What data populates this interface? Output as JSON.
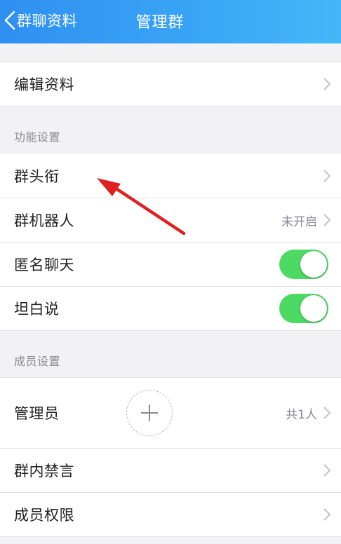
{
  "header": {
    "back_label": "群聊资料",
    "title": "管理群"
  },
  "rows": {
    "edit_info": "编辑资料",
    "title_badge": "群头衔",
    "group_bot": "群机器人",
    "group_bot_value": "未开启",
    "anonymous_chat": "匿名聊天",
    "anonymous_chat_on": true,
    "honest_say": "坦白说",
    "honest_say_on": true,
    "admins": "管理员",
    "admins_value": "共1人",
    "mute": "群内禁言",
    "permissions": "成员权限"
  },
  "sections": {
    "features": "功能设置",
    "members": "成员设置"
  },
  "colors": {
    "header_start": "#2f8ff0",
    "header_end": "#45b7f8",
    "toggle_on": "#4cd964",
    "annotation_arrow": "#e02020"
  },
  "icons": {
    "back": "chevron-left-icon",
    "chevron": "chevron-right-icon",
    "add": "plus-icon"
  }
}
